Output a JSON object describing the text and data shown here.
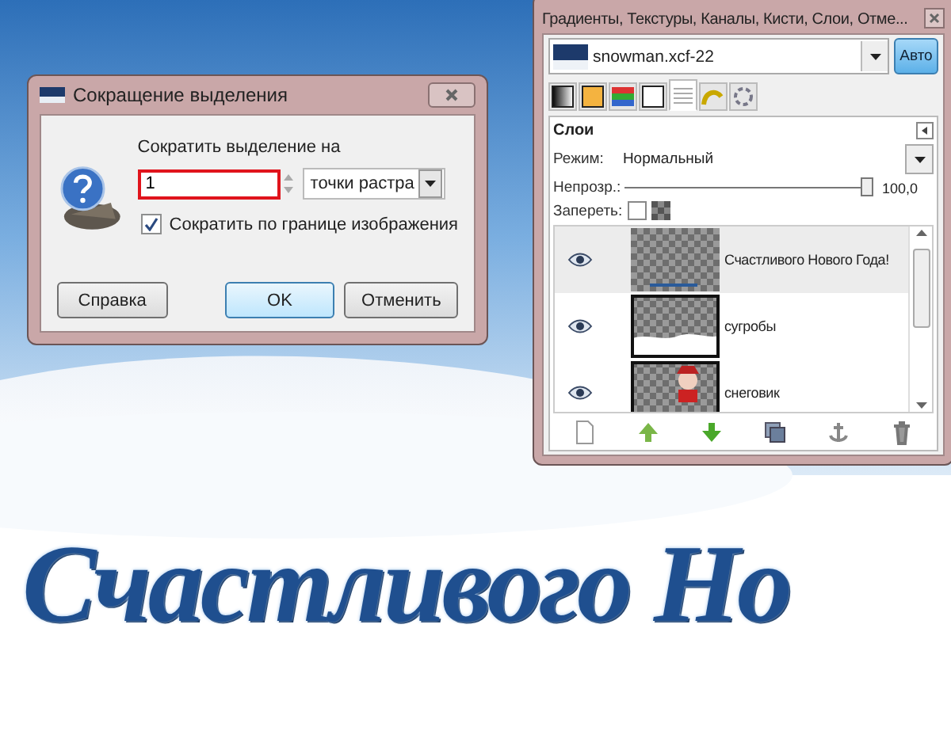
{
  "canvas": {
    "text": "Счастливого Но"
  },
  "shrink_dialog": {
    "title": "Сокращение выделения",
    "label": "Сократить выделение на",
    "value": "1",
    "unit": "точки растра",
    "checkbox": {
      "label": "Сократить по границе изображения",
      "checked": true
    },
    "buttons": [
      {
        "label": "Справка",
        "kind": "help"
      },
      {
        "label": "OK",
        "kind": "default"
      },
      {
        "label": "Отменить",
        "kind": "cancel"
      }
    ]
  },
  "layers_dock": {
    "title": "Градиенты, Текстуры, Каналы, Кисти, Слои, Отме...",
    "image": "snowman.xcf-22",
    "auto_button": "Авто",
    "tabs": [
      {
        "kind": "gradient",
        "selected": false
      },
      {
        "kind": "pattern",
        "selected": false
      },
      {
        "kind": "palette",
        "selected": false
      },
      {
        "kind": "brush",
        "selected": false
      },
      {
        "kind": "layers",
        "selected": true
      },
      {
        "kind": "paths",
        "selected": false
      },
      {
        "kind": "undo",
        "selected": false
      }
    ],
    "panel_title": "Слои",
    "mode_label": "Режим:",
    "mode": "Нормальный",
    "opacity_label": "Непрозр.:",
    "opacity": {
      "level": 1,
      "reading": "100,0"
    },
    "lock_label": "Запереть:",
    "lock_checked": false,
    "layers": [
      {
        "name": "Счастливого Нового Года!",
        "kind": "text",
        "visible": true,
        "selected": true
      },
      {
        "name": "сугробы",
        "kind": "drifts",
        "visible": true,
        "selected": false
      },
      {
        "name": "снеговик",
        "kind": "snowman",
        "visible": true,
        "selected": false
      }
    ],
    "actions": [
      {
        "kind": "new"
      },
      {
        "kind": "raise"
      },
      {
        "kind": "lower"
      },
      {
        "kind": "duplicate"
      },
      {
        "kind": "anchor"
      },
      {
        "kind": "delete"
      }
    ]
  }
}
